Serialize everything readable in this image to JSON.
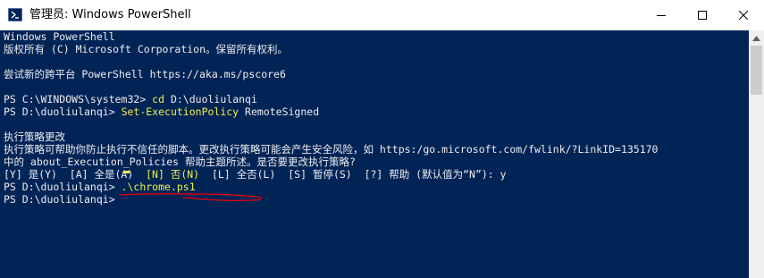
{
  "window": {
    "title": "管理员: Windows PowerShell",
    "icon": "powershell-icon",
    "controls": [
      "minimize-icon",
      "maximize-icon",
      "close-icon"
    ]
  },
  "console": {
    "lines": [
      {
        "segments": [
          {
            "text": "Windows PowerShell"
          }
        ]
      },
      {
        "segments": [
          {
            "text": "版权所有 (C) Microsoft Corporation。保留所有权利。"
          }
        ]
      },
      {
        "segments": [
          {
            "text": ""
          }
        ]
      },
      {
        "segments": [
          {
            "text": "尝试新的跨平台 PowerShell https://aka.ms/pscore6"
          }
        ]
      },
      {
        "segments": [
          {
            "text": ""
          }
        ]
      },
      {
        "segments": [
          {
            "text": "PS C:\\WINDOWS\\system32> "
          },
          {
            "text": "cd",
            "yellow": true
          },
          {
            "text": " D:\\duoliulanqi"
          }
        ]
      },
      {
        "segments": [
          {
            "text": "PS D:\\duoliulanqi> "
          },
          {
            "text": "Set-ExecutionPolicy",
            "yellow": true
          },
          {
            "text": " RemoteSigned"
          }
        ]
      },
      {
        "segments": [
          {
            "text": ""
          }
        ]
      },
      {
        "segments": [
          {
            "text": "执行策略更改"
          }
        ]
      },
      {
        "segments": [
          {
            "text": "执行策略可帮助你防止执行不信任的脚本。更改执行策略可能会产生安全风险，如 https:/go.microsoft.com/fwlink/?LinkID=135170"
          }
        ]
      },
      {
        "segments": [
          {
            "text": "中的 about_Execution_Policies 帮助主题所述。是否要更改执行策略?"
          }
        ]
      },
      {
        "segments": [
          {
            "text": "[Y] 是(Y)  [A] 全是(A)  "
          },
          {
            "text": "[N] 否(N)",
            "yellow": true
          },
          {
            "text": "  [L] 全否(L)  [S] 暂停(S)  [?] 帮助 (默认值为“N”): y"
          }
        ]
      },
      {
        "segments": [
          {
            "text": "PS D:\\duoliulanqi> "
          },
          {
            "text": ".\\chrome.ps1",
            "yellow": true
          }
        ]
      },
      {
        "segments": [
          {
            "text": "PS D:\\duoliulanqi> "
          }
        ]
      }
    ]
  },
  "colors": {
    "console_bg": "#012456",
    "console_text": "#eeedf0",
    "command_highlight": "#f0f048",
    "annotation": "#e8000b",
    "titlebar_bg": "#ffffff"
  }
}
